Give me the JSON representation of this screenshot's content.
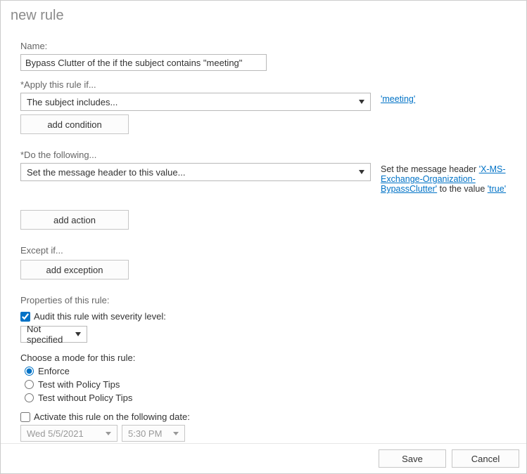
{
  "dialog": {
    "title": "new rule"
  },
  "name": {
    "label": "Name:",
    "value": "Bypass Clutter of the if the subject contains \"meeting\""
  },
  "apply_if": {
    "label": "*Apply this rule if...",
    "selected": "The subject includes...",
    "add_condition_label": "add condition",
    "side_link": "'meeting'"
  },
  "do_following": {
    "label": "*Do the following...",
    "selected": "Set the message header to this value...",
    "add_action_label": "add action",
    "side_text_pre": "Set the message header ",
    "side_link1": "'X-MS-Exchange-Organization-BypassClutter'",
    "side_text_mid": " to the value ",
    "side_link2": "'true'"
  },
  "except_if": {
    "label": "Except if...",
    "add_exception_label": "add exception"
  },
  "properties": {
    "label": "Properties of this rule:",
    "audit_label": "Audit this rule with severity level:",
    "audit_checked": true,
    "severity_selected": "Not specified",
    "mode_label": "Choose a mode for this rule:",
    "modes": {
      "enforce": "Enforce",
      "test_tips": "Test with Policy Tips",
      "test_notips": "Test without Policy Tips"
    },
    "mode_selected": "enforce",
    "activate_label": "Activate this rule on the following date:",
    "activate_checked": false,
    "activate_date": "Wed 5/5/2021",
    "activate_time": "5:30 PM"
  },
  "footer": {
    "save": "Save",
    "cancel": "Cancel"
  }
}
